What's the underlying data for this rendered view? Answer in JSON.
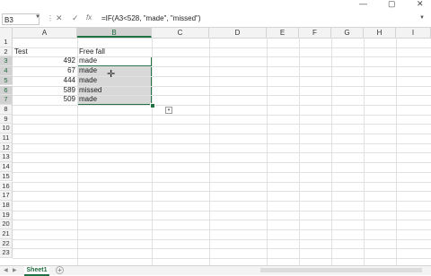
{
  "window": {
    "minimize_glyph": "—",
    "restore_glyph": "▢",
    "close_glyph": "✕"
  },
  "formula_bar": {
    "name_box": "B3",
    "cancel_glyph": "✕",
    "enter_glyph": "✓",
    "fx_label": "fx",
    "formula": "=IF(A3<528, \"made\", \"missed\")"
  },
  "columns": [
    "A",
    "B",
    "C",
    "D",
    "E",
    "F",
    "G",
    "H",
    "I"
  ],
  "rows": [
    "1",
    "2",
    "3",
    "4",
    "5",
    "6",
    "7",
    "8",
    "9",
    "10",
    "11",
    "12",
    "13",
    "14",
    "15",
    "16",
    "17",
    "18",
    "19",
    "20",
    "21",
    "22",
    "23"
  ],
  "cells": {
    "A2": "Test",
    "B2": "Free fall",
    "A3": "492",
    "B3": "made",
    "A4": "67",
    "B4": "made",
    "A5": "444",
    "B5": "made",
    "A6": "589",
    "B6": "missed",
    "A7": "509",
    "B7": "made"
  },
  "sheet": {
    "tab_label": "Sheet1",
    "add_glyph": "+"
  },
  "accent_color": "#217346"
}
